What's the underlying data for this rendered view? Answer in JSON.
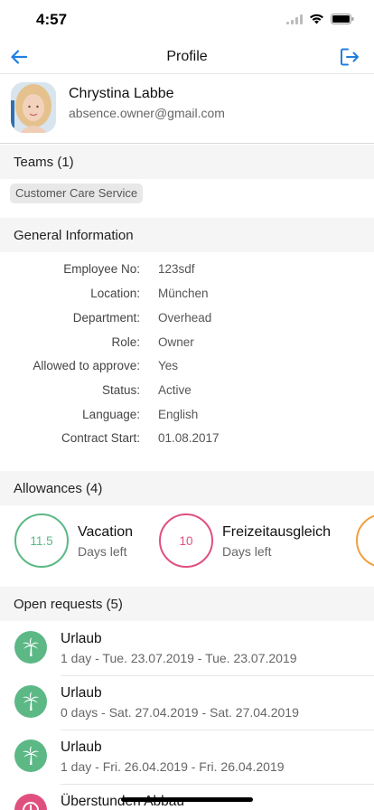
{
  "status_bar": {
    "time": "4:57"
  },
  "nav": {
    "title": "Profile",
    "back_icon": "arrow-left-icon",
    "logout_icon": "logout-icon",
    "accent": "#1e7fe0"
  },
  "profile": {
    "name": "Chrystina Labbe",
    "email": "absence.owner@gmail.com"
  },
  "teams": {
    "header": "Teams (1)",
    "items": [
      "Customer Care Service"
    ]
  },
  "general": {
    "header": "General Information",
    "rows": [
      {
        "label": "Employee No:",
        "value": "123sdf"
      },
      {
        "label": "Location:",
        "value": "München"
      },
      {
        "label": "Department:",
        "value": "Overhead"
      },
      {
        "label": "Role:",
        "value": "Owner"
      },
      {
        "label": "Allowed to approve:",
        "value": "Yes"
      },
      {
        "label": "Status:",
        "value": "Active"
      },
      {
        "label": "Language:",
        "value": "English"
      },
      {
        "label": "Contract Start:",
        "value": "01.08.2017"
      }
    ]
  },
  "allowances": {
    "header": "Allowances (4)",
    "items": [
      {
        "value": "11.5",
        "title": "Vacation",
        "subtitle": "Days left",
        "color": "#5cb885"
      },
      {
        "value": "10",
        "title": "Freizeitausgleich",
        "subtitle": "Days left",
        "color": "#e0507f"
      },
      {
        "value": "",
        "title": "",
        "subtitle": "",
        "color": "#f0a040"
      }
    ]
  },
  "requests": {
    "header": "Open requests (5)",
    "items": [
      {
        "title": "Urlaub",
        "subtitle": "1 day - Tue. 23.07.2019 - Tue. 23.07.2019",
        "icon": "palm-tree-icon",
        "color": "#5cb885"
      },
      {
        "title": "Urlaub",
        "subtitle": "0 days - Sat. 27.04.2019 - Sat. 27.04.2019",
        "icon": "palm-tree-icon",
        "color": "#5cb885"
      },
      {
        "title": "Urlaub",
        "subtitle": "1 day - Fri. 26.04.2019 - Fri. 26.04.2019",
        "icon": "palm-tree-icon",
        "color": "#5cb885"
      },
      {
        "title": "Überstunden Abbau",
        "subtitle": "",
        "icon": "clock-icon",
        "color": "#e0507f"
      }
    ]
  }
}
